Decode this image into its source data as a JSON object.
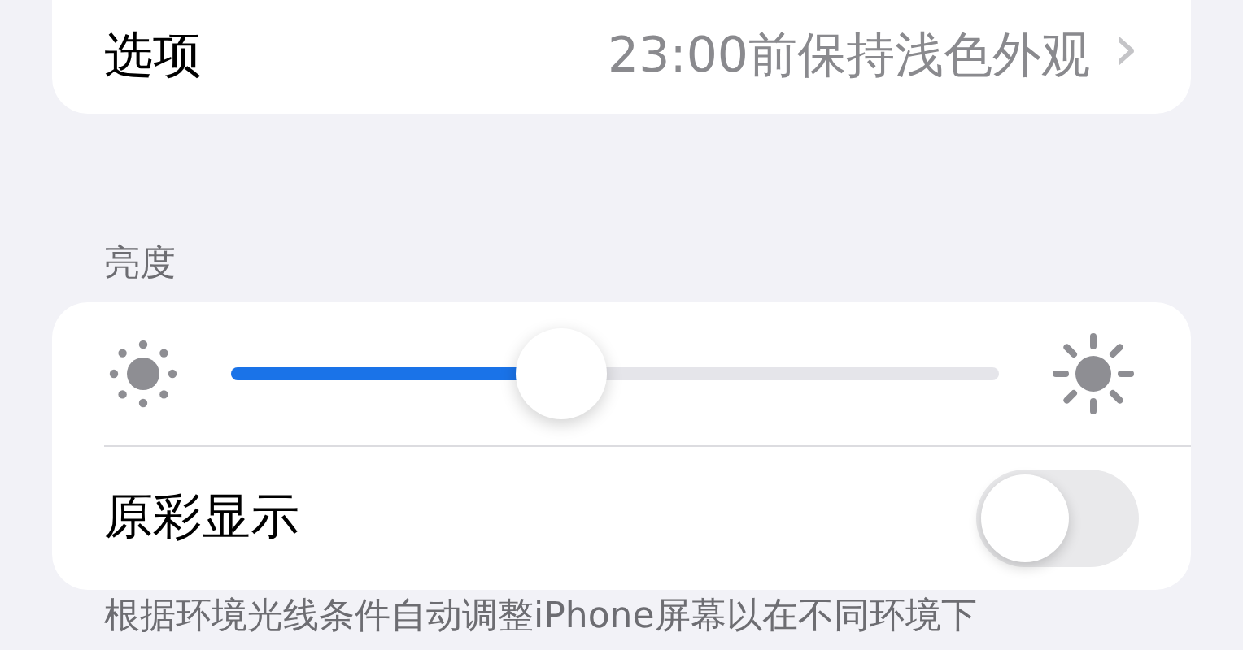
{
  "options_row": {
    "label": "选项",
    "value": "23:00前保持浅色外观",
    "chevron": "›"
  },
  "brightness": {
    "header": "亮度",
    "slider": {
      "level": 0.43
    }
  },
  "true_tone": {
    "label": "原彩显示",
    "on": false
  },
  "footer": "根据环境光线条件自动调整iPhone屏幕以在不同环境下"
}
